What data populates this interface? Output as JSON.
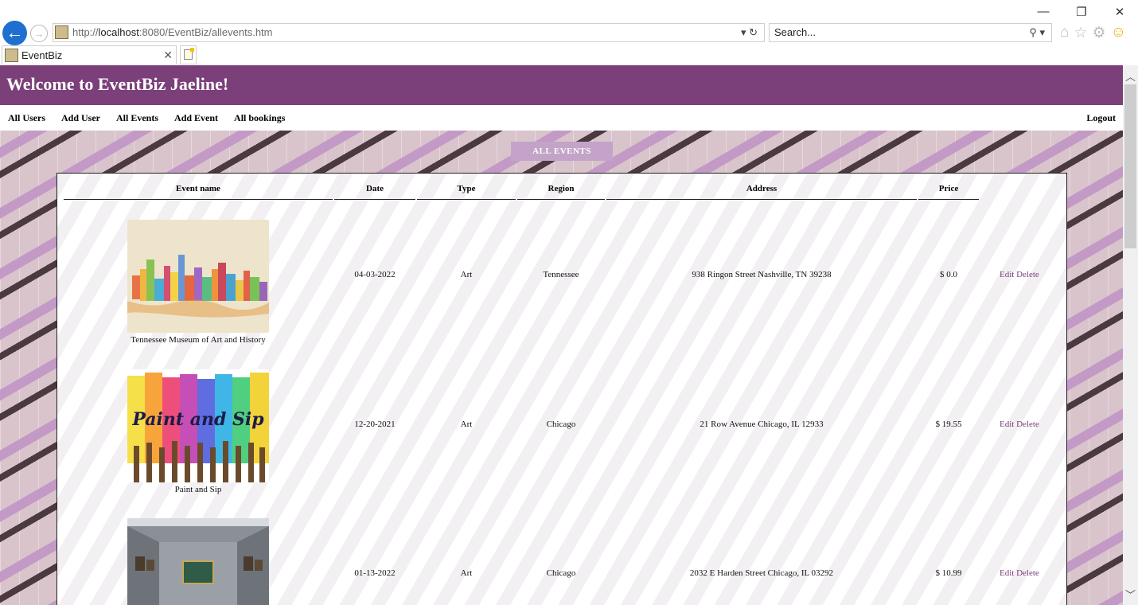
{
  "browser": {
    "url_prefix": "http://",
    "url_host": "localhost",
    "url_rest": ":8080/EventBiz/allevents.htm",
    "search_placeholder": "Search...",
    "tab_title": "EventBiz",
    "window_controls": [
      "—",
      "❐",
      "✕"
    ],
    "addr_controls": "▾ ↻",
    "search_icon": "⚲ ▾",
    "tool_icons": [
      "⌂",
      "☆",
      "⚙",
      "☺"
    ]
  },
  "header": {
    "title": "Welcome to EventBiz Jaeline!"
  },
  "menu": {
    "items": [
      "All Users",
      "Add User",
      "All Events",
      "Add Event",
      "All bookings"
    ],
    "logout": "Logout"
  },
  "section_button": "ALL EVENTS",
  "table": {
    "headers": [
      "Event name",
      "Date",
      "Type",
      "Region",
      "Address",
      "Price"
    ],
    "rows": [
      {
        "name": "Tennessee Museum of Art and History",
        "date": "04-03-2022",
        "type": "Art",
        "region": "Tennessee",
        "address": "938 Ringon Street Nashville, TN 39238",
        "price": "$ 0.0",
        "image": "skyline-watercolor"
      },
      {
        "name": "Paint and Sip",
        "date": "12-20-2021",
        "type": "Art",
        "region": "Chicago",
        "address": "21 Row Avenue Chicago, IL 12933",
        "price": "$ 19.55",
        "image": "paint-brushes",
        "image_text": "Paint and Sip"
      },
      {
        "name": "",
        "date": "01-13-2022",
        "type": "Art",
        "region": "Chicago",
        "address": "2032 E Harden Street Chicago, IL 03292",
        "price": "$ 10.99",
        "image": "gallery-room"
      }
    ],
    "edit_label": "Edit",
    "delete_label": "Delete"
  },
  "colors": {
    "brand": "#7b3f79",
    "button": "#c3a3c8"
  }
}
